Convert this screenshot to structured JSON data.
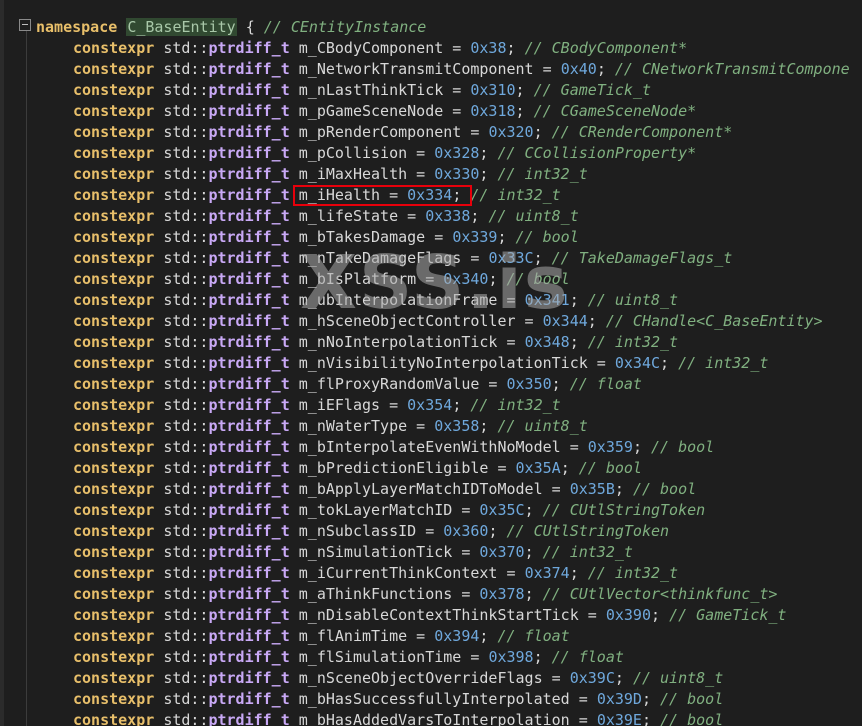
{
  "namespace": {
    "keyword": "namespace",
    "name": "C_BaseEntity",
    "brace": "{",
    "comment": "// CEntityInstance"
  },
  "watermark": "XSS.is",
  "members": [
    {
      "name": "m_CBodyComponent",
      "value": "0x38",
      "comment": "// CBodyComponent*"
    },
    {
      "name": "m_NetworkTransmitComponent",
      "value": "0x40",
      "comment": "// CNetworkTransmitCompone"
    },
    {
      "name": "m_nLastThinkTick",
      "value": "0x310",
      "comment": "// GameTick_t"
    },
    {
      "name": "m_pGameSceneNode",
      "value": "0x318",
      "comment": "// CGameSceneNode*"
    },
    {
      "name": "m_pRenderComponent",
      "value": "0x320",
      "comment": "// CRenderComponent*"
    },
    {
      "name": "m_pCollision",
      "value": "0x328",
      "comment": "// CCollisionProperty*"
    },
    {
      "name": "m_iMaxHealth",
      "value": "0x330",
      "comment": "// int32_t"
    },
    {
      "name": "m_iHealth",
      "value": "0x334",
      "comment": "// int32_t"
    },
    {
      "name": "m_lifeState",
      "value": "0x338",
      "comment": "// uint8_t"
    },
    {
      "name": "m_bTakesDamage",
      "value": "0x339",
      "comment": "// bool"
    },
    {
      "name": "m_nTakeDamageFlags",
      "value": "0x33C",
      "comment": "// TakeDamageFlags_t"
    },
    {
      "name": "m_bIsPlatform",
      "value": "0x340",
      "comment": "// bool"
    },
    {
      "name": "m_ubInterpolationFrame",
      "value": "0x341",
      "comment": "// uint8_t"
    },
    {
      "name": "m_hSceneObjectController",
      "value": "0x344",
      "comment": "// CHandle<C_BaseEntity>"
    },
    {
      "name": "m_nNoInterpolationTick",
      "value": "0x348",
      "comment": "// int32_t"
    },
    {
      "name": "m_nVisibilityNoInterpolationTick",
      "value": "0x34C",
      "comment": "// int32_t"
    },
    {
      "name": "m_flProxyRandomValue",
      "value": "0x350",
      "comment": "// float"
    },
    {
      "name": "m_iEFlags",
      "value": "0x354",
      "comment": "// int32_t"
    },
    {
      "name": "m_nWaterType",
      "value": "0x358",
      "comment": "// uint8_t"
    },
    {
      "name": "m_bInterpolateEvenWithNoModel",
      "value": "0x359",
      "comment": "// bool"
    },
    {
      "name": "m_bPredictionEligible",
      "value": "0x35A",
      "comment": "// bool"
    },
    {
      "name": "m_bApplyLayerMatchIDToModel",
      "value": "0x35B",
      "comment": "// bool"
    },
    {
      "name": "m_tokLayerMatchID",
      "value": "0x35C",
      "comment": "// CUtlStringToken"
    },
    {
      "name": "m_nSubclassID",
      "value": "0x360",
      "comment": "// CUtlStringToken"
    },
    {
      "name": "m_nSimulationTick",
      "value": "0x370",
      "comment": "// int32_t"
    },
    {
      "name": "m_iCurrentThinkContext",
      "value": "0x374",
      "comment": "// int32_t"
    },
    {
      "name": "m_aThinkFunctions",
      "value": "0x378",
      "comment": "// CUtlVector<thinkfunc_t>"
    },
    {
      "name": "m_nDisableContextThinkStartTick",
      "value": "0x390",
      "comment": "// GameTick_t"
    },
    {
      "name": "m_flAnimTime",
      "value": "0x394",
      "comment": "// float"
    },
    {
      "name": "m_flSimulationTime",
      "value": "0x398",
      "comment": "// float"
    },
    {
      "name": "m_nSceneObjectOverrideFlags",
      "value": "0x39C",
      "comment": "// uint8_t"
    },
    {
      "name": "m_bHasSuccessfullyInterpolated",
      "value": "0x39D",
      "comment": "// bool"
    },
    {
      "name": "m_bHasAddedVarsToInterpolation",
      "value": "0x39E",
      "comment": "// bool"
    }
  ],
  "tokens": {
    "constexpr": "constexpr",
    "std": "std::",
    "ptrdiff": "ptrdiff_t",
    "eq": " = ",
    "semi": ";"
  },
  "colors": {
    "background": "#1e1e1e",
    "keyword": "#e8bf6a",
    "number": "#6fa8dc",
    "comment": "#80b080",
    "highlight_box": "#e8000b"
  }
}
